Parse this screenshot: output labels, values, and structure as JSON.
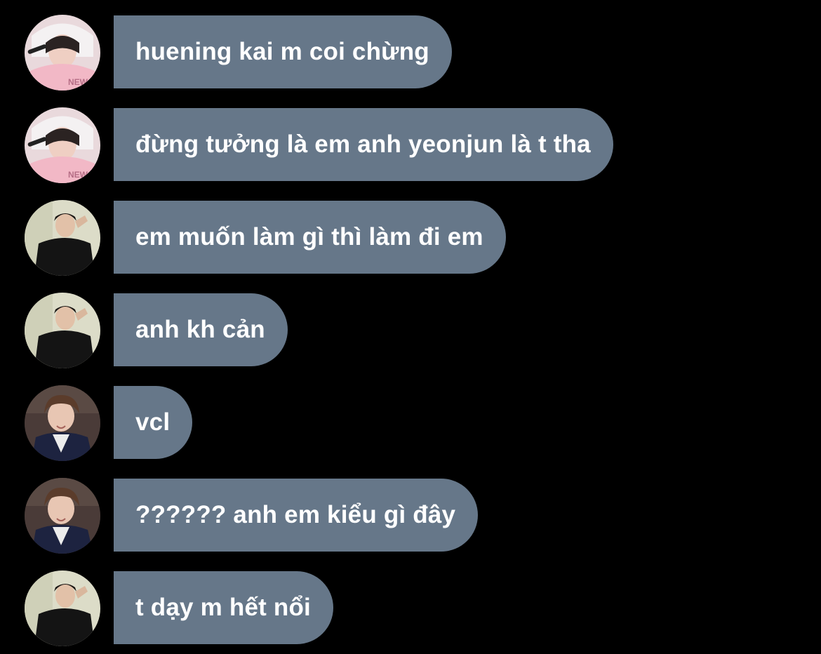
{
  "messages": [
    {
      "sender_avatar": "avatar-pink-hoodie",
      "text": "huening kai m coi chừng"
    },
    {
      "sender_avatar": "avatar-pink-hoodie",
      "text": "đừng tưởng là em anh yeonjun là t tha"
    },
    {
      "sender_avatar": "avatar-black-outfit",
      "text": "em muốn làm gì thì làm đi em"
    },
    {
      "sender_avatar": "avatar-black-outfit",
      "text": "anh kh cản"
    },
    {
      "sender_avatar": "avatar-hanbok",
      "text": "vcl"
    },
    {
      "sender_avatar": "avatar-hanbok",
      "text": "?????? anh em kiểu gì đây"
    },
    {
      "sender_avatar": "avatar-black-outfit",
      "text": "t dạy m hết nổi"
    }
  ],
  "colors": {
    "background": "#000000",
    "bubble": "#667789",
    "text": "#ffffff"
  }
}
